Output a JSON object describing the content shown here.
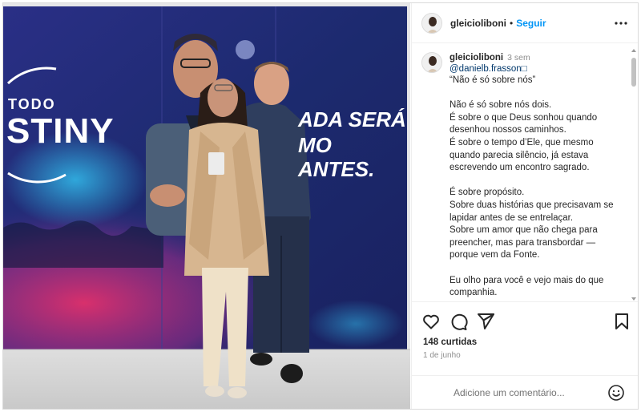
{
  "post": {
    "author": {
      "username": "gleicioliboni",
      "separator": "•",
      "follow_label": "Seguir"
    },
    "photo": {
      "banner_left_text_line1": "TODO",
      "banner_left_text_line2": "STINY",
      "banner_right_text_line1": "ADA SERÁ",
      "banner_right_text_line2": "MO ANTES."
    },
    "caption": {
      "username": "gleicioliboni",
      "time": "3 sem",
      "mention": "@danielb.frasson□",
      "text": "“Não é só sobre nós”\n\nNão é só sobre nós dois.\nÉ sobre o que Deus sonhou quando desenhou nossos caminhos.\nÉ sobre o tempo d’Ele, que mesmo quando parecia silêncio, já estava escrevendo um encontro sagrado.\n\nÉ sobre propósito.\nSobre duas histórias que precisavam se lapidar antes de se entrelaçar.\nSobre um amor que não chega para preencher, mas para transbordar — porque vem da Fonte.\n\nEu olho para você e vejo mais do que companhia.\nVejo cuidado divino."
    },
    "actions": {
      "icons": [
        "heart-icon",
        "comment-icon",
        "share-icon",
        "bookmark-icon"
      ],
      "likes": "148 curtidas",
      "date": "1 de junho"
    },
    "comment": {
      "placeholder": "Adicione um comentário...",
      "value": ""
    },
    "colors": {
      "accent": "#0095f6",
      "text": "#262626",
      "muted": "#8e8e8e",
      "link": "#00376b",
      "banner_dark": "#1e2a78",
      "banner_pink": "#d0346a"
    }
  }
}
